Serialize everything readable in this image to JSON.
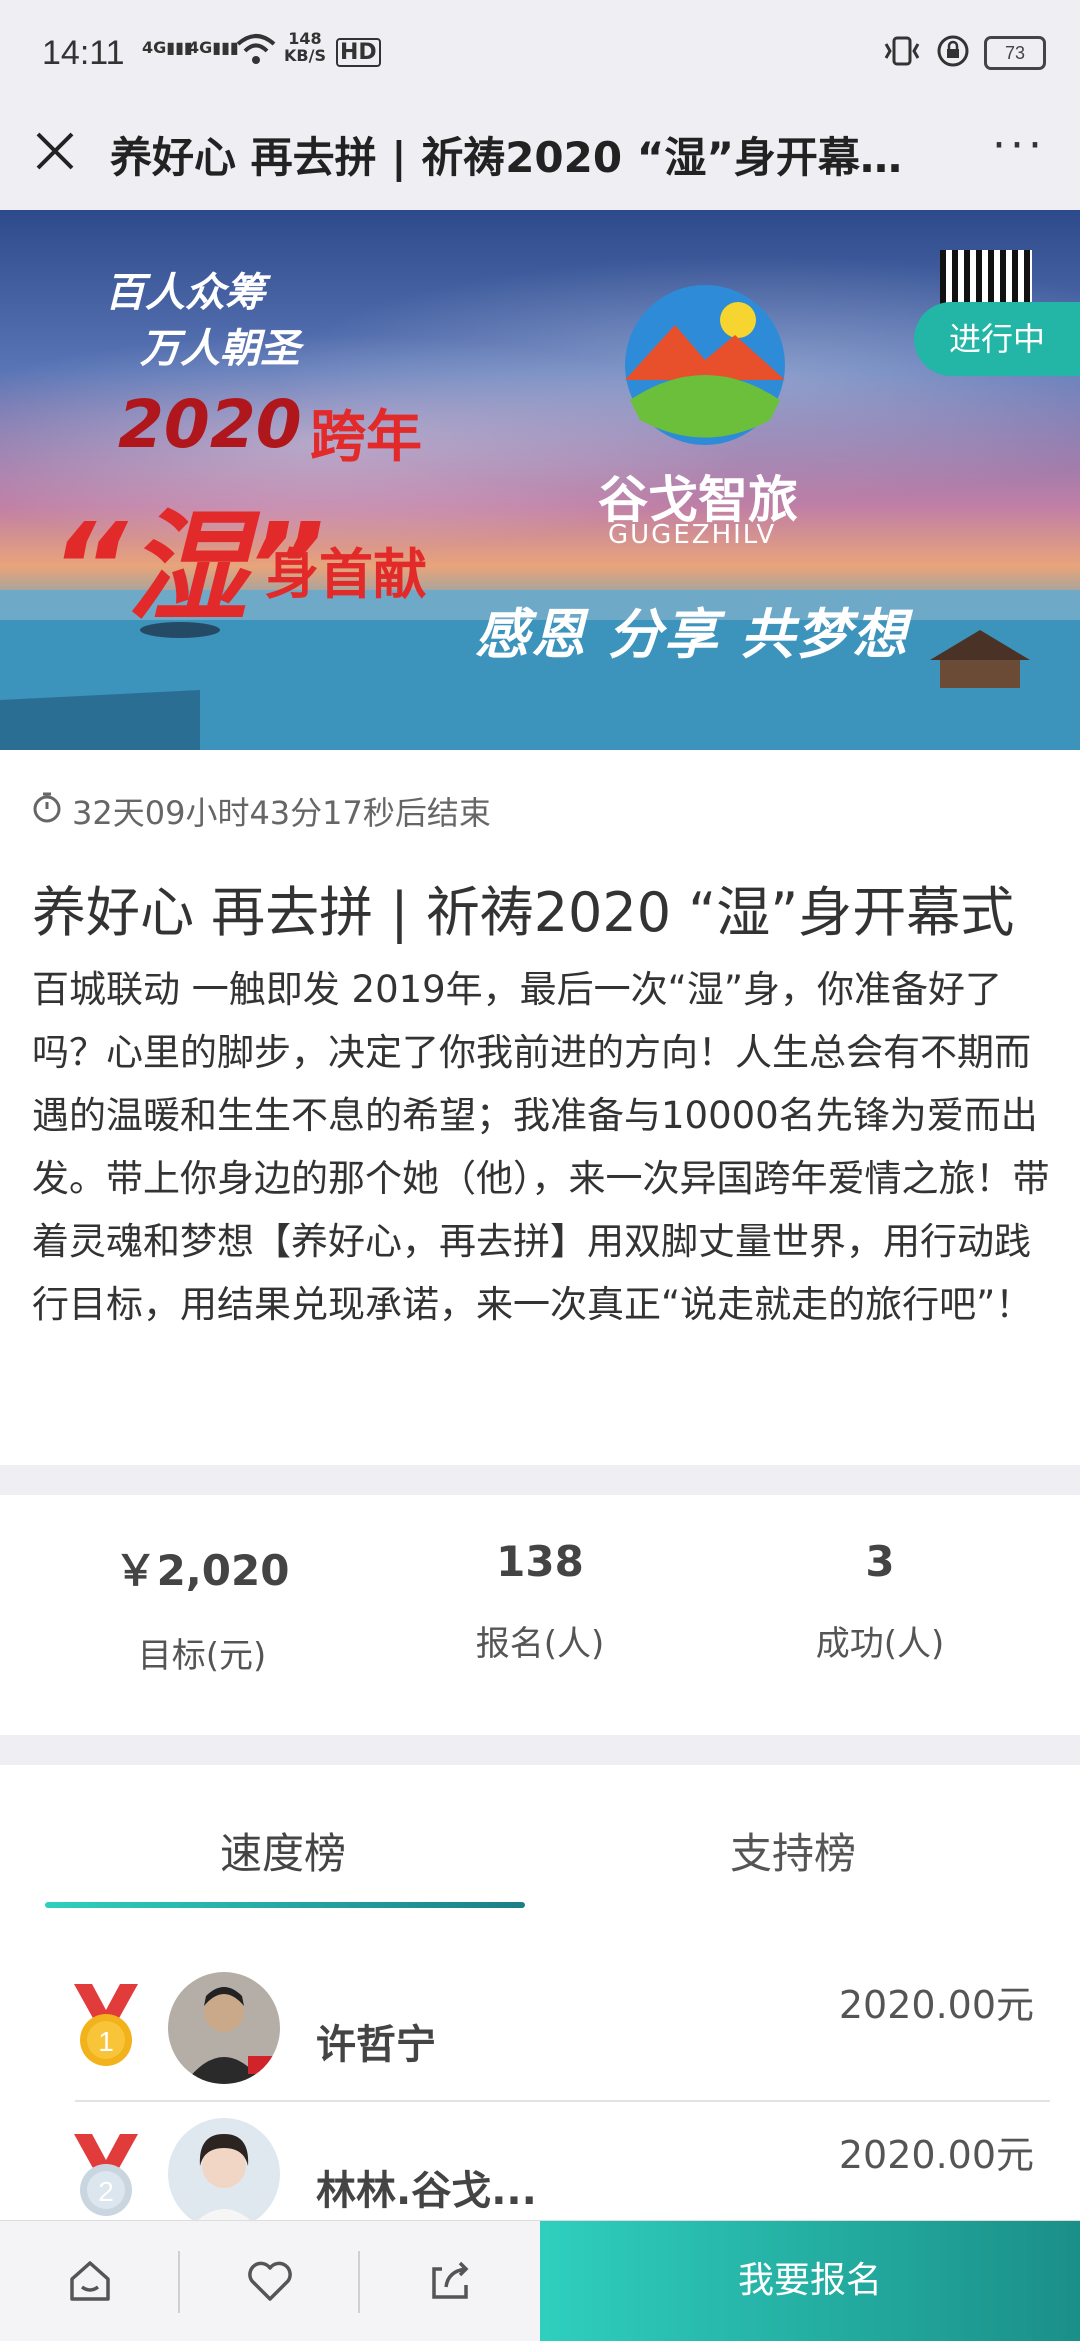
{
  "status_bar": {
    "time": "14:11",
    "net1": "4G",
    "net2": "4G",
    "speed": "148",
    "speed_unit": "KB/S",
    "hd": "HD",
    "battery": "73"
  },
  "header": {
    "title": "养好心 再去拼 | 祈祷2020 “湿”身开幕式|...",
    "more": "···"
  },
  "banner": {
    "line1": "百人众筹",
    "line2": "万人朝圣",
    "year": "2020",
    "kuanian": "跨年",
    "shi": "“湿”",
    "shenshouxian": "身首献",
    "brand": "谷戈智旅",
    "brand_en": "GUGEZHILV",
    "slogan": "感恩 分享 共梦想",
    "status_badge": "进行中"
  },
  "event": {
    "countdown": "32天09小时43分17秒后结束",
    "title": "养好心 再去拼 | 祈祷2020 “湿”身开幕式",
    "description": "百城联动 一触即发 2019年，最后一次“湿”身，你准备好了吗？心里的脚步，决定了你我前进的方向！人生总会有不期而遇的温暖和生生不息的希望；我准备与10000名先锋为爱而出发。带上你身边的那个她（他），来一次异国跨年爱情之旅！带着灵魂和梦想【养好心，再去拼】用双脚丈量世界，用行动践行目标，用结果兑现承诺，来一次真正“说走就走的旅行吧”！"
  },
  "stats": [
    {
      "value": "￥2,020",
      "label": "目标(元)"
    },
    {
      "value": "138",
      "label": "报名(人)"
    },
    {
      "value": "3",
      "label": "成功(人)"
    }
  ],
  "tabs": [
    {
      "label": "速度榜",
      "active": true
    },
    {
      "label": "支持榜",
      "active": false
    }
  ],
  "ranking": [
    {
      "rank": "1",
      "name": "许哲宁",
      "amount": "2020.00元"
    },
    {
      "rank": "2",
      "name": "林林.谷戈...",
      "amount": "2020.00元"
    }
  ],
  "bottom_bar": {
    "icons": [
      "home-icon",
      "heart-icon",
      "share-icon"
    ],
    "signup_label": "我要报名"
  },
  "colors": {
    "accent": "#23b5a6",
    "accent_dark": "#1a8f88",
    "medal_red": "#e23b3b",
    "medal_gold": "#f2b21b",
    "medal_silver": "#c9d6e0"
  }
}
